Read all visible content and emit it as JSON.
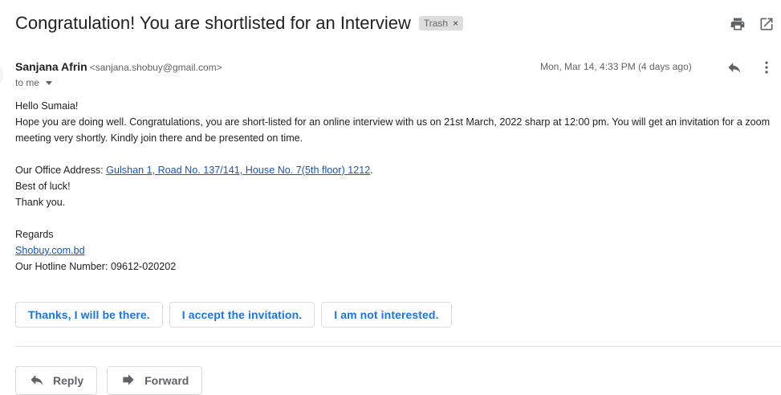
{
  "email": {
    "subject": "Congratulation! You are shortlisted for an Interview",
    "label": "Trash",
    "label_remove": "×",
    "sender_name": "Sanjana Afrin",
    "sender_email": "<sanjana.shobuy@gmail.com>",
    "recipient": "to me",
    "date": "Mon, Mar 14, 4:33 PM (4 days ago)",
    "body": {
      "greeting": "Hello Sumaia!",
      "paragraph": "Hope you are doing well. Congratulations, you are short-listed for an online interview with us on 21st March, 2022 sharp at 12:00 pm. You will get an invitation for a zoom meeting very shortly. Kindly join there and be presented on time.",
      "address_label": "Our Office Address: ",
      "address_link": "Gulshan 1, Road No. 137/141, House No. 7(5th floor) 1212",
      "address_end": ".",
      "luck": "Best of luck!",
      "thanks": "Thank you.",
      "regards": "Regards",
      "website": "Shobuy.com.bd",
      "hotline": "Our Hotline Number: 09612-020202"
    }
  },
  "smart_replies": [
    "Thanks, I will be there.",
    "I accept the invitation.",
    "I am not interested."
  ],
  "actions": {
    "reply": "Reply",
    "forward": "Forward"
  },
  "icons": {
    "print": "print-icon",
    "open_new": "open-in-new-window-icon",
    "reply": "reply-icon",
    "more": "more-vertical-icon",
    "forward": "forward-icon"
  },
  "colors": {
    "link": "#1155cc",
    "smart_reply_text": "#1a73e8",
    "chip_bg": "#dddddd"
  }
}
